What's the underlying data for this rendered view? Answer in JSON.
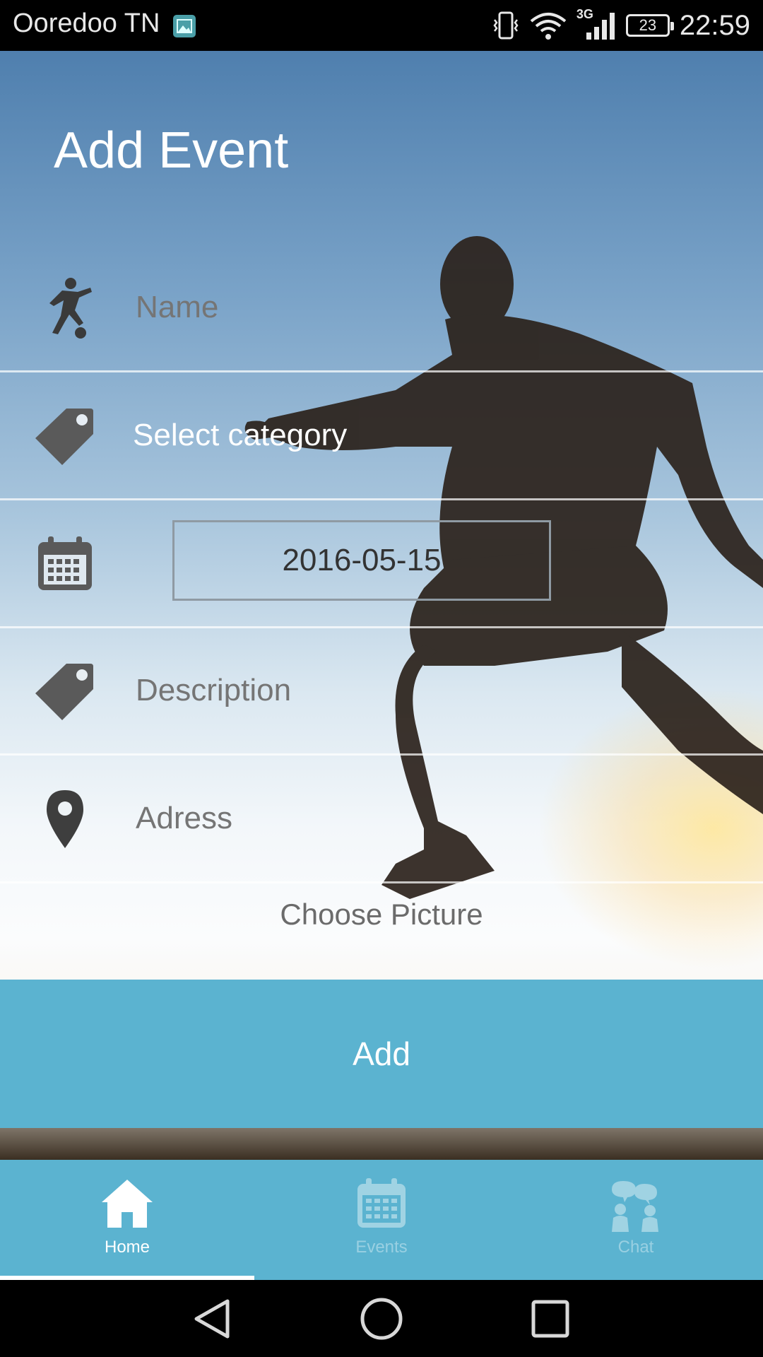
{
  "status_bar": {
    "carrier": "Ooredoo TN",
    "network": "3G",
    "battery": "23",
    "time": "22:59"
  },
  "screen": {
    "title": "Add Event"
  },
  "form": {
    "name_placeholder": "Name",
    "category_placeholder": "Select category",
    "date_value": "2016-05-15",
    "description_placeholder": "Description",
    "address_placeholder": "Adress",
    "choose_picture_label": "Choose Picture",
    "add_label": "Add"
  },
  "tabs": [
    {
      "label": "Home",
      "icon": "home-icon",
      "active": true
    },
    {
      "label": "Events",
      "icon": "calendar-icon",
      "active": false
    },
    {
      "label": "Chat",
      "icon": "chat-icon",
      "active": false
    }
  ],
  "colors": {
    "accent": "#5bb3d0",
    "status_bar": "#000000",
    "icon_gray": "#5a5a5a"
  }
}
